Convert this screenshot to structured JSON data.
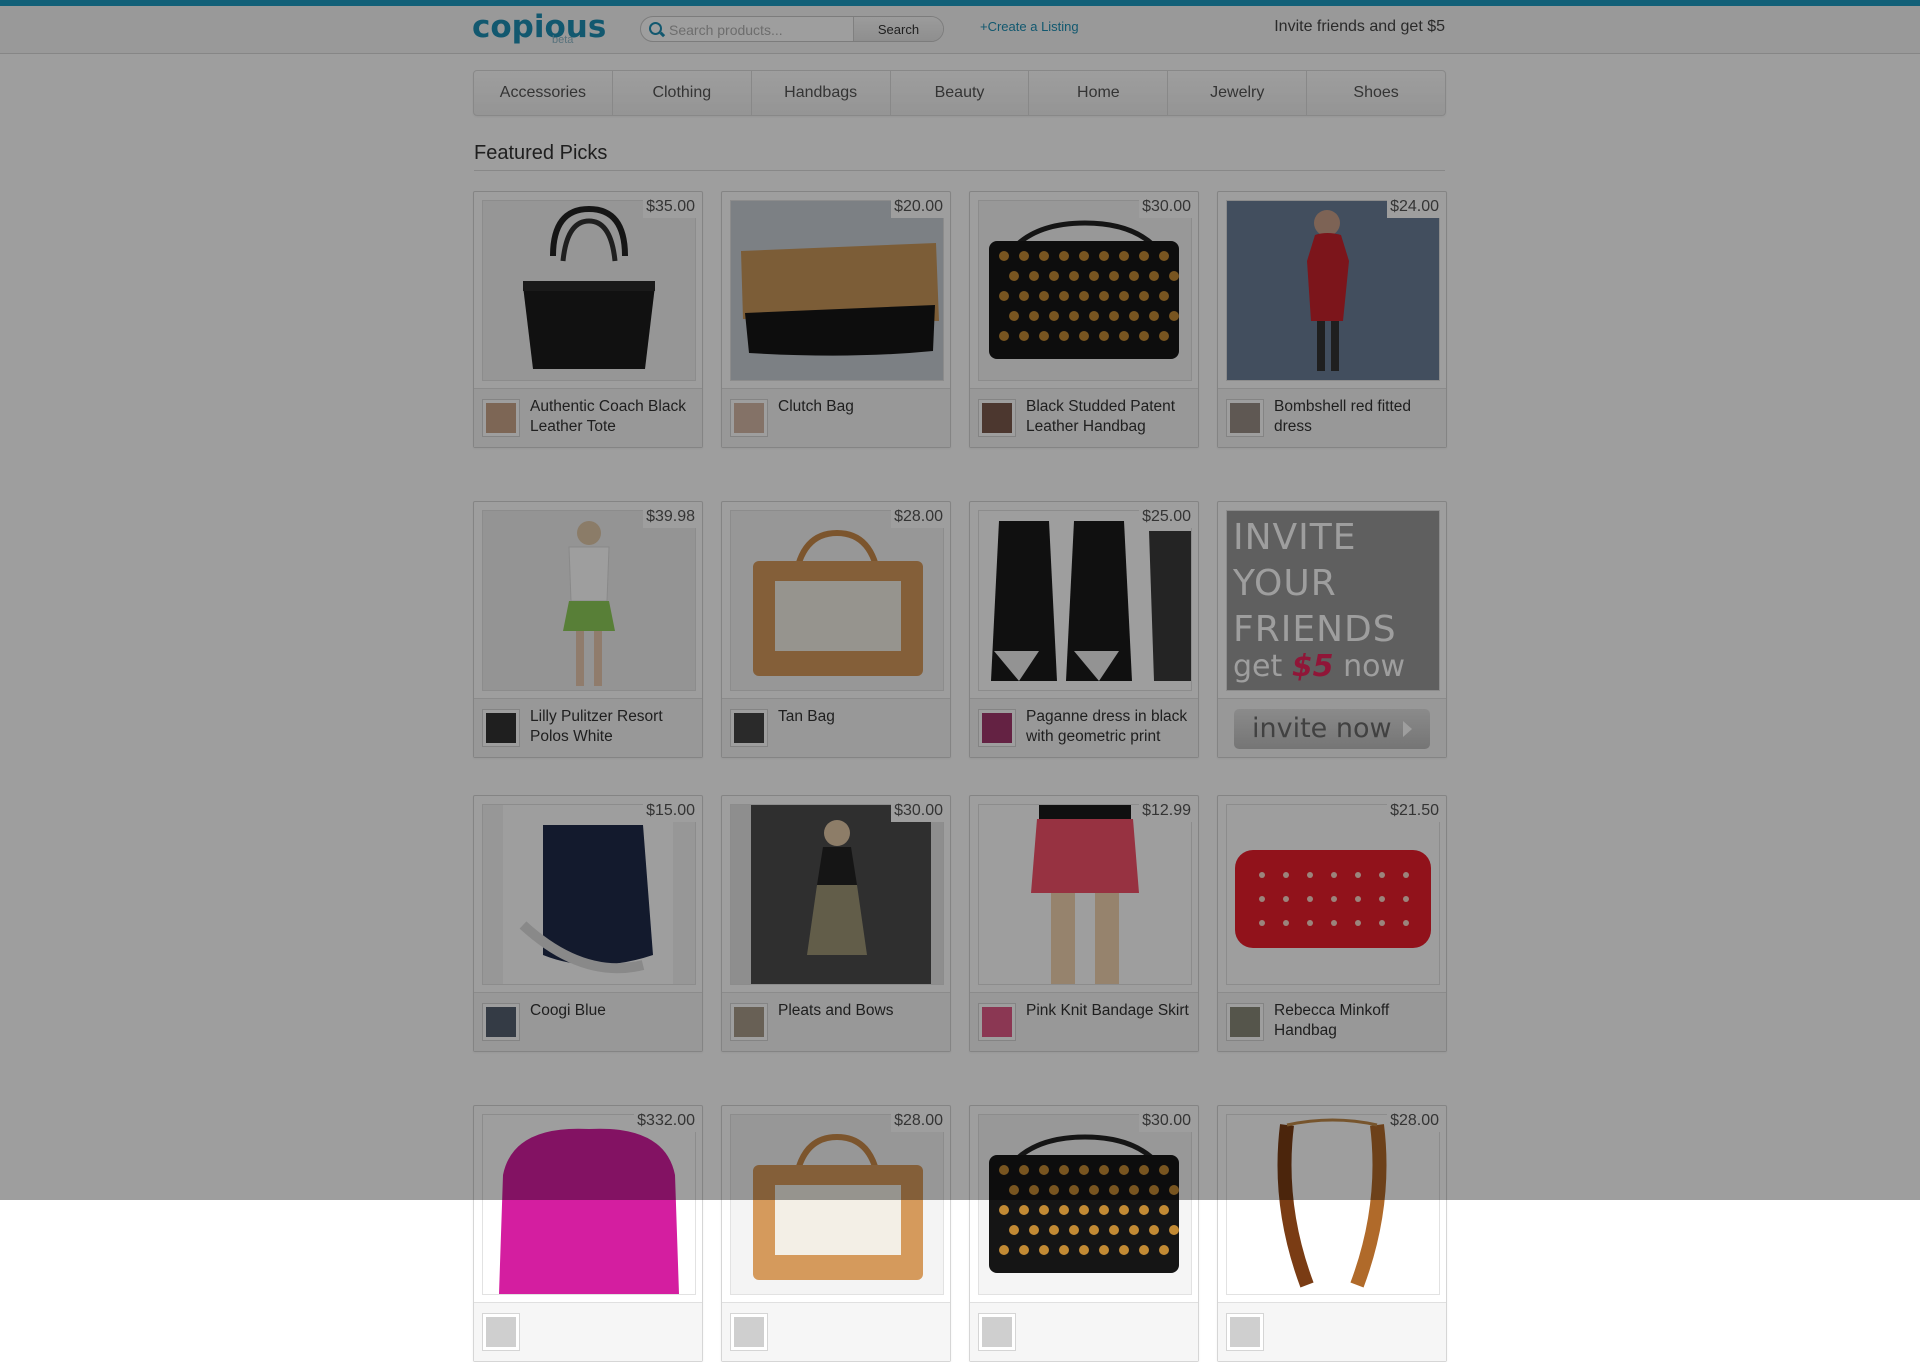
{
  "header": {
    "logo": "copious",
    "logo_sub": "beta",
    "search_placeholder": "Search products...",
    "search_button": "Search",
    "create_link": "+Create a Listing",
    "invite_text": "Invite friends and get $5"
  },
  "nav": [
    "Accessories",
    "Clothing",
    "Handbags",
    "Beauty",
    "Home",
    "Jewelry",
    "Shoes"
  ],
  "section_title": "Featured Picks",
  "listings": [
    {
      "price": "$35.00",
      "title": "Authentic Coach Black Leather Tote",
      "img": "black-leather-tote"
    },
    {
      "price": "$20.00",
      "title": "Clutch Bag",
      "img": "wood-black-clutch"
    },
    {
      "price": "$30.00",
      "title": "Black Studded Patent Leather Handbag",
      "img": "black-studded-handbag"
    },
    {
      "price": "$24.00",
      "title": "Bombshell red fitted dress",
      "img": "red-dress-model"
    },
    {
      "price": "$39.98",
      "title": "Lilly Pulitzer Resort Polos White",
      "img": "model-polo-green-skirt"
    },
    {
      "price": "$28.00",
      "title": "Tan Bag",
      "img": "tan-cream-bag"
    },
    {
      "price": "$25.00",
      "title": "Paganne dress in black with geometric print",
      "img": "black-geometric-dress"
    },
    {
      "price": "$15.00",
      "title": "Coogi Blue",
      "img": "navy-sneakers"
    },
    {
      "price": "$30.00",
      "title": "Pleats and Bows",
      "img": "pleated-dress-model"
    },
    {
      "price": "$12.99",
      "title": "Pink Knit Bandage Skirt",
      "img": "pink-skirt"
    },
    {
      "price": "$21.50",
      "title": "Rebecca Minkoff Handbag",
      "img": "red-studded-wallet"
    },
    {
      "price": "$332.00",
      "title": "",
      "img": "magenta-bag"
    },
    {
      "price": "$28.00",
      "title": "",
      "img": "tan-cream-bag"
    },
    {
      "price": "$30.00",
      "title": "",
      "img": "black-studded-handbag"
    },
    {
      "price": "$28.00",
      "title": "",
      "img": "braided-necklace"
    }
  ],
  "invite_card": {
    "lines": [
      "INVITE",
      "YOUR",
      "FRIENDS"
    ],
    "get": "get",
    "amount": "$5",
    "now": "now",
    "button": "invite now"
  },
  "colors": {
    "accent": "#1e9bc2",
    "link": "#1e8fb4",
    "highlight": "#e8245b"
  }
}
